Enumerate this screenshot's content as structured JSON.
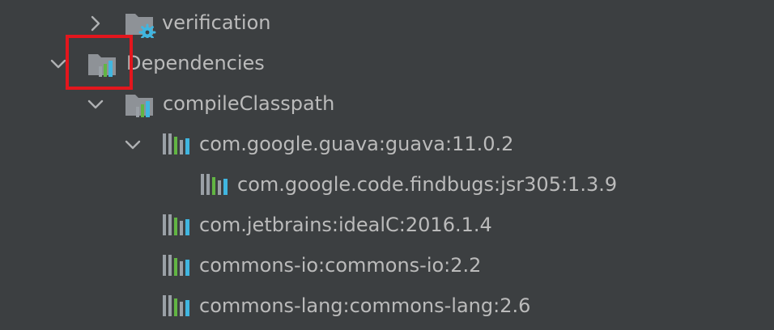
{
  "tree": {
    "nodes": [
      {
        "label": "verification",
        "icon": "task-folder-gear-icon",
        "expanded": false
      },
      {
        "label": "Dependencies",
        "icon": "dependencies-folder-icon",
        "expanded": true
      },
      {
        "label": "compileClasspath",
        "icon": "dependencies-folder-icon",
        "expanded": true
      },
      {
        "label": "com.google.guava:guava:11.0.2",
        "icon": "library-icon",
        "expanded": true
      },
      {
        "label": "com.google.code.findbugs:jsr305:1.3.9",
        "icon": "library-icon"
      },
      {
        "label": "com.jetbrains:idealC:2016.1.4",
        "icon": "library-icon"
      },
      {
        "label": "commons-io:commons-io:2.2",
        "icon": "library-icon"
      },
      {
        "label": "commons-lang:commons-lang:2.6",
        "icon": "library-icon"
      }
    ]
  },
  "colors": {
    "background": "#3c3f41",
    "text": "#bbbbbb",
    "folder": "#8e9297",
    "bar_gray": "#9aa0a6",
    "bar_green": "#62b543",
    "bar_blue": "#40b6e0",
    "highlight": "#e3161d"
  }
}
